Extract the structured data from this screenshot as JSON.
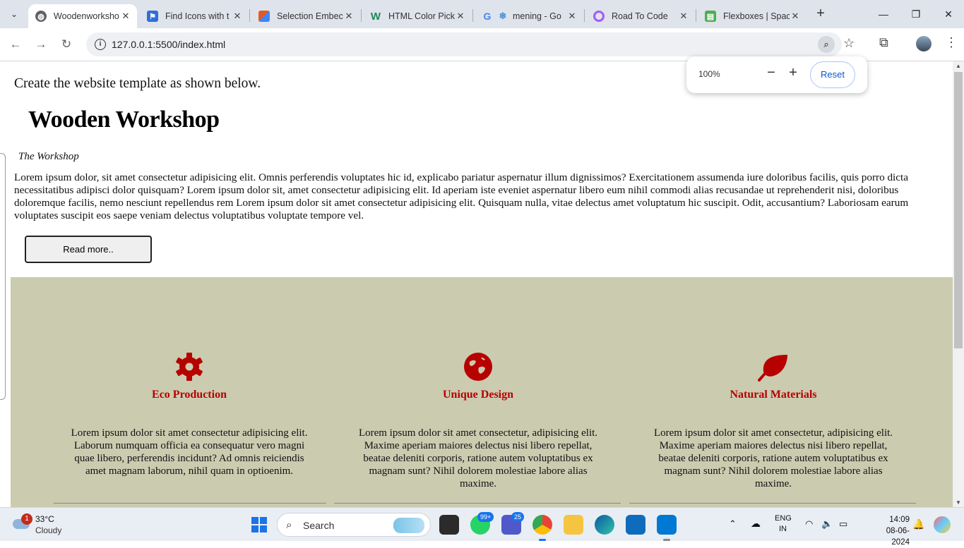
{
  "browser": {
    "tabs": [
      {
        "title": "Woodenworksho",
        "favicon_color": "#5f6368",
        "active": true
      },
      {
        "title": "Find Icons with t",
        "favicon_color": "#2f6fd6",
        "active": false
      },
      {
        "title": "Selection Embec",
        "favicon_color": "#e05a28",
        "active": false
      },
      {
        "title": "HTML Color Pick",
        "favicon_color": "#1b8a5a",
        "active": false
      },
      {
        "title": "mening - Go",
        "favicon_color": "#4285f4",
        "active": false
      },
      {
        "title": "Road To Code",
        "favicon_color": "#a259ff",
        "active": false
      },
      {
        "title": "Flexboxes | Spac",
        "favicon_color": "#4caf50",
        "active": false
      }
    ],
    "url": "127.0.0.1:5500/index.html",
    "zoom_popup": {
      "value": "100%",
      "minus": "−",
      "plus": "+",
      "reset": "Reset"
    }
  },
  "page": {
    "intro": "Create the website template as shown below.",
    "title": "Wooden Workshop",
    "subtitle": "The Workshop",
    "paragraph": "Lorem ipsum dolor, sit amet consectetur adipisicing elit. Omnis perferendis voluptates hic id, explicabo pariatur aspernatur illum dignissimos? Exercitationem assumenda iure doloribus facilis, quis porro dicta necessitatibus adipisci dolor quisquam? Lorem ipsum dolor sit, amet consectetur adipisicing elit. Id aperiam iste eveniet aspernatur libero eum nihil commodi alias recusandae ut reprehenderit nisi, doloribus doloremque facilis, nemo nesciunt repellendus rem Lorem ipsum dolor sit amet consectetur adipisicing elit. Quisquam nulla, vitae delectus amet voluptatum hic suscipit. Odit, accusantium? Laboriosam earum voluptates suscipit eos saepe veniam delectus voluptatibus voluptate tempore vel.",
    "read_more": "Read more..",
    "band_color": "#cbcbb0",
    "accent_color": "#b70000",
    "features": [
      {
        "icon": "gear-icon",
        "title": "Eco Production",
        "text": "Lorem ipsum dolor sit amet consectetur adipisicing elit. Laborum numquam officia ea consequatur vero magni quae libero, perferendis incidunt? Ad omnis reiciendis amet magnam laborum, nihil quam in optioenim."
      },
      {
        "icon": "globe-icon",
        "title": "Unique Design",
        "text": "Lorem ipsum dolor sit amet consectetur, adipisicing elit. Maxime aperiam maiores delectus nisi libero repellat, beatae deleniti corporis, ratione autem voluptatibus ex magnam sunt? Nihil dolorem molestiae labore alias maxime."
      },
      {
        "icon": "leaf-icon",
        "title": "Natural Materials",
        "text": "Lorem ipsum dolor sit amet consectetur, adipisicing elit. Maxime aperiam maiores delectus nisi libero repellat, beatae deleniti corporis, ratione autem voluptatibus ex magnam sunt? Nihil dolorem molestiae labore alias maxime."
      }
    ]
  },
  "taskbar": {
    "weather_badge": "1",
    "temperature": "33°C",
    "condition": "Cloudy",
    "search": "Search",
    "whatsapp_badge": "99+",
    "teams_badge": "25",
    "lang_top": "ENG",
    "lang_bottom": "IN",
    "time": "14:09",
    "date": "08-06-2024"
  }
}
